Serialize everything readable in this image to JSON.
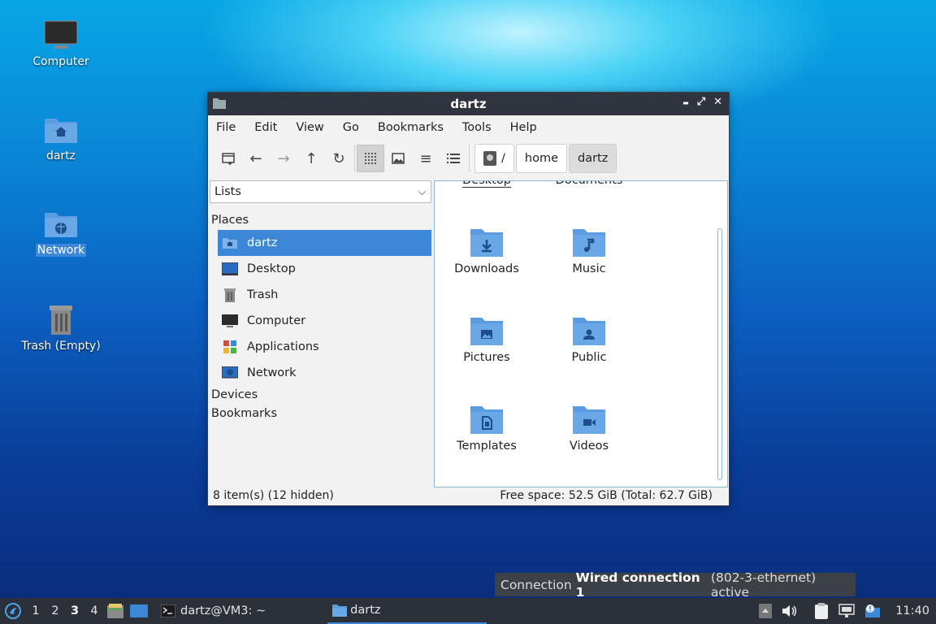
{
  "desktop": {
    "icons": [
      {
        "label": "Computer"
      },
      {
        "label": "dartz"
      },
      {
        "label": "Network"
      },
      {
        "label": "Trash (Empty)"
      }
    ]
  },
  "window": {
    "title": "dartz",
    "controls": {
      "minimize": "▬",
      "maximize": "⤢",
      "close": "✕"
    },
    "menu": [
      "File",
      "Edit",
      "View",
      "Go",
      "Bookmarks",
      "Tools",
      "Help"
    ],
    "breadcrumb": [
      "/",
      "home",
      "dartz"
    ],
    "side": {
      "combo_value": "Lists",
      "places_header": "Places",
      "places": [
        {
          "label": "dartz"
        },
        {
          "label": "Desktop"
        },
        {
          "label": "Trash"
        },
        {
          "label": "Computer"
        },
        {
          "label": "Applications"
        },
        {
          "label": "Network"
        }
      ],
      "devices_header": "Devices",
      "bookmarks_header": "Bookmarks"
    },
    "items": [
      {
        "label": "Desktop",
        "glyph": ""
      },
      {
        "label": "Documents",
        "glyph": ""
      },
      {
        "label": "Downloads",
        "glyph": "download"
      },
      {
        "label": "Music",
        "glyph": "music"
      },
      {
        "label": "Pictures",
        "glyph": "image"
      },
      {
        "label": "Public",
        "glyph": "user"
      },
      {
        "label": "Templates",
        "glyph": "document"
      },
      {
        "label": "Videos",
        "glyph": "video"
      }
    ],
    "status": {
      "left": "8 item(s) (12 hidden)",
      "right": "Free space: 52.5 GiB (Total: 62.7 GiB)"
    }
  },
  "notification": {
    "prefix": "Connection ",
    "name": "Wired connection 1",
    "suffix": "(802-3-ethernet) active"
  },
  "taskbar": {
    "workspaces": [
      "1",
      "2",
      "3",
      "4"
    ],
    "active_workspace": "3",
    "tasks": [
      {
        "label": "dartz@VM3: ~"
      },
      {
        "label": "dartz"
      }
    ],
    "clock": "11:40"
  },
  "colors": {
    "accent": "#3d87d8",
    "folder": "#5b9bdf",
    "folder_dark": "#1f4f8a"
  }
}
